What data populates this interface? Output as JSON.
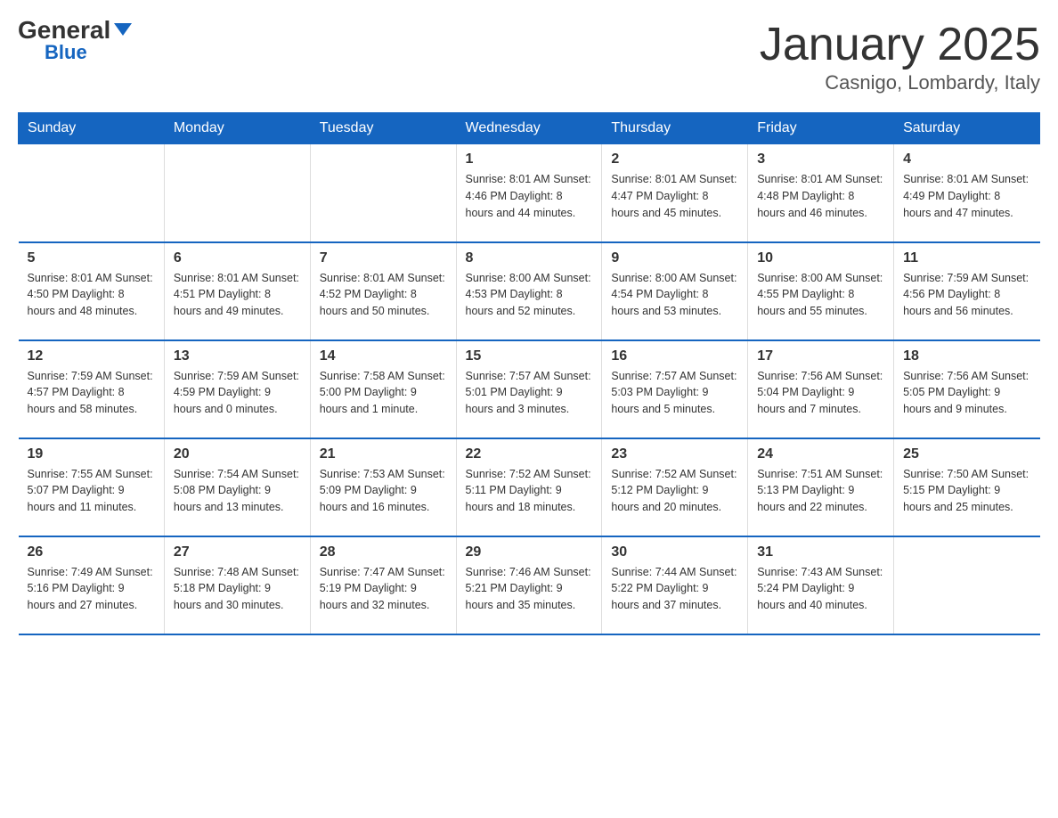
{
  "header": {
    "logo_general": "General",
    "logo_blue": "Blue",
    "month_title": "January 2025",
    "location": "Casnigo, Lombardy, Italy"
  },
  "days_of_week": [
    "Sunday",
    "Monday",
    "Tuesday",
    "Wednesday",
    "Thursday",
    "Friday",
    "Saturday"
  ],
  "weeks": [
    [
      {
        "day": "",
        "info": ""
      },
      {
        "day": "",
        "info": ""
      },
      {
        "day": "",
        "info": ""
      },
      {
        "day": "1",
        "info": "Sunrise: 8:01 AM\nSunset: 4:46 PM\nDaylight: 8 hours\nand 44 minutes."
      },
      {
        "day": "2",
        "info": "Sunrise: 8:01 AM\nSunset: 4:47 PM\nDaylight: 8 hours\nand 45 minutes."
      },
      {
        "day": "3",
        "info": "Sunrise: 8:01 AM\nSunset: 4:48 PM\nDaylight: 8 hours\nand 46 minutes."
      },
      {
        "day": "4",
        "info": "Sunrise: 8:01 AM\nSunset: 4:49 PM\nDaylight: 8 hours\nand 47 minutes."
      }
    ],
    [
      {
        "day": "5",
        "info": "Sunrise: 8:01 AM\nSunset: 4:50 PM\nDaylight: 8 hours\nand 48 minutes."
      },
      {
        "day": "6",
        "info": "Sunrise: 8:01 AM\nSunset: 4:51 PM\nDaylight: 8 hours\nand 49 minutes."
      },
      {
        "day": "7",
        "info": "Sunrise: 8:01 AM\nSunset: 4:52 PM\nDaylight: 8 hours\nand 50 minutes."
      },
      {
        "day": "8",
        "info": "Sunrise: 8:00 AM\nSunset: 4:53 PM\nDaylight: 8 hours\nand 52 minutes."
      },
      {
        "day": "9",
        "info": "Sunrise: 8:00 AM\nSunset: 4:54 PM\nDaylight: 8 hours\nand 53 minutes."
      },
      {
        "day": "10",
        "info": "Sunrise: 8:00 AM\nSunset: 4:55 PM\nDaylight: 8 hours\nand 55 minutes."
      },
      {
        "day": "11",
        "info": "Sunrise: 7:59 AM\nSunset: 4:56 PM\nDaylight: 8 hours\nand 56 minutes."
      }
    ],
    [
      {
        "day": "12",
        "info": "Sunrise: 7:59 AM\nSunset: 4:57 PM\nDaylight: 8 hours\nand 58 minutes."
      },
      {
        "day": "13",
        "info": "Sunrise: 7:59 AM\nSunset: 4:59 PM\nDaylight: 9 hours\nand 0 minutes."
      },
      {
        "day": "14",
        "info": "Sunrise: 7:58 AM\nSunset: 5:00 PM\nDaylight: 9 hours\nand 1 minute."
      },
      {
        "day": "15",
        "info": "Sunrise: 7:57 AM\nSunset: 5:01 PM\nDaylight: 9 hours\nand 3 minutes."
      },
      {
        "day": "16",
        "info": "Sunrise: 7:57 AM\nSunset: 5:03 PM\nDaylight: 9 hours\nand 5 minutes."
      },
      {
        "day": "17",
        "info": "Sunrise: 7:56 AM\nSunset: 5:04 PM\nDaylight: 9 hours\nand 7 minutes."
      },
      {
        "day": "18",
        "info": "Sunrise: 7:56 AM\nSunset: 5:05 PM\nDaylight: 9 hours\nand 9 minutes."
      }
    ],
    [
      {
        "day": "19",
        "info": "Sunrise: 7:55 AM\nSunset: 5:07 PM\nDaylight: 9 hours\nand 11 minutes."
      },
      {
        "day": "20",
        "info": "Sunrise: 7:54 AM\nSunset: 5:08 PM\nDaylight: 9 hours\nand 13 minutes."
      },
      {
        "day": "21",
        "info": "Sunrise: 7:53 AM\nSunset: 5:09 PM\nDaylight: 9 hours\nand 16 minutes."
      },
      {
        "day": "22",
        "info": "Sunrise: 7:52 AM\nSunset: 5:11 PM\nDaylight: 9 hours\nand 18 minutes."
      },
      {
        "day": "23",
        "info": "Sunrise: 7:52 AM\nSunset: 5:12 PM\nDaylight: 9 hours\nand 20 minutes."
      },
      {
        "day": "24",
        "info": "Sunrise: 7:51 AM\nSunset: 5:13 PM\nDaylight: 9 hours\nand 22 minutes."
      },
      {
        "day": "25",
        "info": "Sunrise: 7:50 AM\nSunset: 5:15 PM\nDaylight: 9 hours\nand 25 minutes."
      }
    ],
    [
      {
        "day": "26",
        "info": "Sunrise: 7:49 AM\nSunset: 5:16 PM\nDaylight: 9 hours\nand 27 minutes."
      },
      {
        "day": "27",
        "info": "Sunrise: 7:48 AM\nSunset: 5:18 PM\nDaylight: 9 hours\nand 30 minutes."
      },
      {
        "day": "28",
        "info": "Sunrise: 7:47 AM\nSunset: 5:19 PM\nDaylight: 9 hours\nand 32 minutes."
      },
      {
        "day": "29",
        "info": "Sunrise: 7:46 AM\nSunset: 5:21 PM\nDaylight: 9 hours\nand 35 minutes."
      },
      {
        "day": "30",
        "info": "Sunrise: 7:44 AM\nSunset: 5:22 PM\nDaylight: 9 hours\nand 37 minutes."
      },
      {
        "day": "31",
        "info": "Sunrise: 7:43 AM\nSunset: 5:24 PM\nDaylight: 9 hours\nand 40 minutes."
      },
      {
        "day": "",
        "info": ""
      }
    ]
  ]
}
